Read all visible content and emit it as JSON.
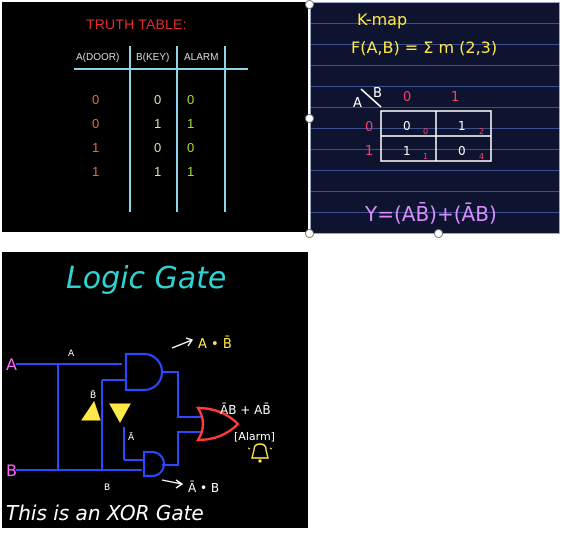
{
  "truth_table": {
    "title": "TRUTH TABLE:",
    "headers": [
      "A(DOOR)",
      "B(KEY)",
      "ALARM"
    ],
    "rows": [
      [
        "0",
        "0",
        "0"
      ],
      [
        "0",
        "1",
        "1"
      ],
      [
        "1",
        "0",
        "0"
      ],
      [
        "1",
        "1",
        "1"
      ]
    ],
    "colors": {
      "a": "#e0703a",
      "b": "#e8d9b0",
      "alarm": "#a6e22e",
      "title": "#e32b2b",
      "grid": "#8fd3e6"
    }
  },
  "kmap": {
    "title": "K-map",
    "function": "F(A,B) = Σ m (2,3)",
    "corner_a": "A",
    "corner_b": "B",
    "col_headers": [
      "0",
      "1"
    ],
    "row_headers": [
      "0",
      "1"
    ],
    "cells": [
      [
        "0",
        "1"
      ],
      [
        "1",
        "0"
      ]
    ],
    "cell_indices": [
      [
        "0",
        "2"
      ],
      [
        "1",
        "4"
      ]
    ],
    "equation": "Y=(AB̄)+(ĀB)",
    "colors": {
      "title": "#ffe94a",
      "function": "#ffe94a",
      "headers": "#ff3b6b",
      "grid": "#ffffff",
      "equation": "#d98cff",
      "index": "#ff3b6b"
    }
  },
  "logic_gate": {
    "title": "Logic Gate",
    "input_a": "A",
    "input_b": "B",
    "wire_label_a": "A",
    "wire_label_b": "B",
    "top_output": "A • B̄",
    "bottom_output": "Ā • B",
    "not_label_top": "B̄",
    "not_label_bottom": "Ā",
    "or_output": "ĀB + AB̄",
    "alarm_label": "[Alarm]",
    "caption": "This is an XOR Gate",
    "colors": {
      "title": "#2fd1d1",
      "wires": "#2a49ff",
      "gate_or": "#ff3b3b",
      "not": "#ffe94a",
      "text": "#ffffff",
      "caption": "#ffffff"
    }
  }
}
